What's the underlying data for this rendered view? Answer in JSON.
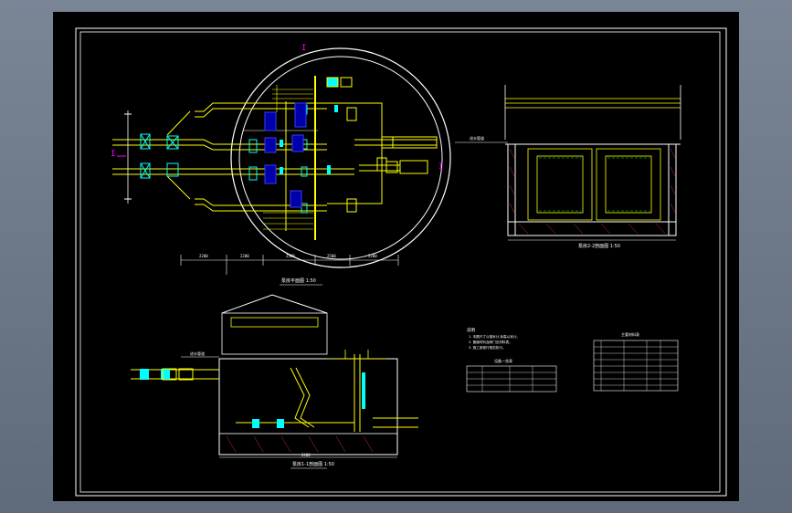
{
  "colors": {
    "background": "#000000",
    "frame": "#ffffff",
    "wall": "#ffffff",
    "pipe": "#ffff00",
    "valve": "#00ffff",
    "equipment": "#0000ff",
    "accent": "#ff00ff",
    "dimension": "#ffffff",
    "water": "#00ff00",
    "hatch": "#ff3b3b"
  },
  "views": {
    "plan": {
      "title": "泵房平面图 1:50"
    },
    "section_a": {
      "title": "泵房1-1剖面图 1:50",
      "label_left": "进水管道",
      "dim_total": "2400"
    },
    "section_b": {
      "title": "泵房2-2剖面图 1:50",
      "label_left": "进水管道"
    }
  },
  "notes": {
    "heading": "说明",
    "lines": [
      "1. 本图尺寸以毫米计,标高以米计。",
      "2. 管道材料及阀门见材料表。",
      "3. 施工按现行规范执行。"
    ]
  },
  "equipment_table": {
    "title": "设备一览表"
  },
  "material_table": {
    "title": "主要材料表"
  }
}
